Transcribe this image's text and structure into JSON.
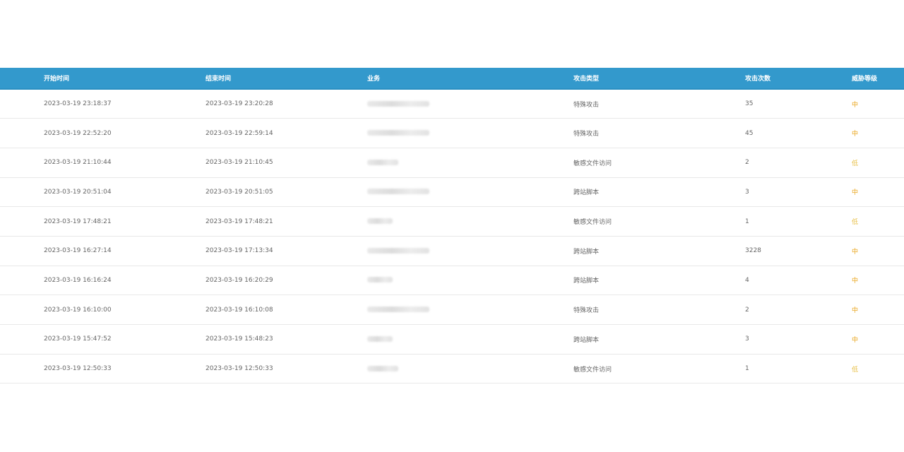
{
  "table": {
    "columns": [
      "开始时间",
      "结束时间",
      "业务",
      "攻击类型",
      "攻击次数",
      "威胁等级"
    ],
    "rows": [
      {
        "start": "2023-03-19 23:18:37",
        "end": "2023-03-19 23:20:28",
        "type": "特殊攻击",
        "count": "35",
        "level": "中",
        "level_kind": "mid"
      },
      {
        "start": "2023-03-19 22:52:20",
        "end": "2023-03-19 22:59:14",
        "type": "特殊攻击",
        "count": "45",
        "level": "中",
        "level_kind": "mid"
      },
      {
        "start": "2023-03-19 21:10:44",
        "end": "2023-03-19 21:10:45",
        "type": "敏感文件访问",
        "count": "2",
        "level": "低",
        "level_kind": "low"
      },
      {
        "start": "2023-03-19 20:51:04",
        "end": "2023-03-19 20:51:05",
        "type": "跨站脚本",
        "count": "3",
        "level": "中",
        "level_kind": "mid"
      },
      {
        "start": "2023-03-19 17:48:21",
        "end": "2023-03-19 17:48:21",
        "type": "敏感文件访问",
        "count": "1",
        "level": "低",
        "level_kind": "low"
      },
      {
        "start": "2023-03-19 16:27:14",
        "end": "2023-03-19 17:13:34",
        "type": "跨站脚本",
        "count": "3228",
        "level": "中",
        "level_kind": "mid"
      },
      {
        "start": "2023-03-19 16:16:24",
        "end": "2023-03-19 16:20:29",
        "type": "跨站脚本",
        "count": "4",
        "level": "中",
        "level_kind": "mid"
      },
      {
        "start": "2023-03-19 16:10:00",
        "end": "2023-03-19 16:10:08",
        "type": "特殊攻击",
        "count": "2",
        "level": "中",
        "level_kind": "mid"
      },
      {
        "start": "2023-03-19 15:47:52",
        "end": "2023-03-19 15:48:23",
        "type": "跨站脚本",
        "count": "3",
        "level": "中",
        "level_kind": "mid"
      },
      {
        "start": "2023-03-19 12:50:33",
        "end": "2023-03-19 12:50:33",
        "type": "敏感文件访问",
        "count": "1",
        "level": "低",
        "level_kind": "low"
      }
    ]
  },
  "colors": {
    "header_bg": "#3399cc",
    "level_mid": "#e8a317",
    "level_low": "#e8c04a"
  }
}
